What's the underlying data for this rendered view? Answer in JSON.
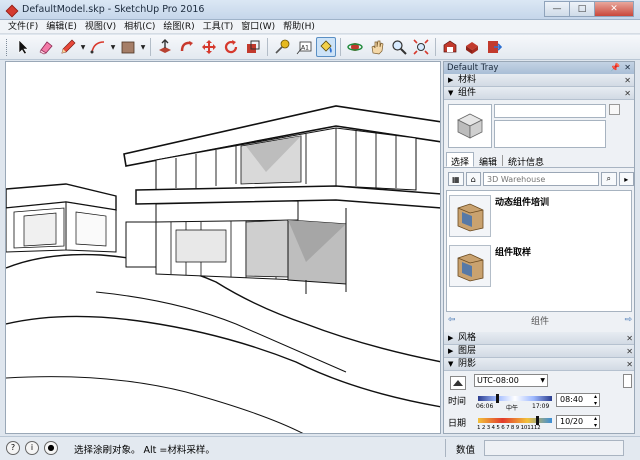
{
  "window": {
    "title": "DefaultModel.skp - SketchUp Pro 2016",
    "minimize": "—",
    "maximize": "□",
    "close": "✕"
  },
  "menu": [
    "文件(F)",
    "编辑(E)",
    "视图(V)",
    "相机(C)",
    "绘图(R)",
    "工具(T)",
    "窗口(W)",
    "帮助(H)"
  ],
  "toolbar": {
    "tools": [
      "select-tool",
      "eraser-tool",
      "pencil-tool",
      "arc-tool",
      "shape-tool",
      "push-pull-tool",
      "follow-me-tool",
      "move-tool",
      "rotate-tool",
      "scale-tool",
      "tape-measure-tool",
      "text-tool",
      "paint-bucket-tool",
      "orbit-tool",
      "pan-tool",
      "zoom-tool",
      "zoom-extents-tool",
      "warehouse-tool",
      "extension-tool",
      "share-tool"
    ],
    "text_tool_label": "A1",
    "active": "paint-bucket-tool"
  },
  "tray": {
    "title": "Default Tray",
    "pin": "📌",
    "close": "✕",
    "panels": {
      "materials": "材料",
      "components": "组件",
      "styles": "风格",
      "layers": "图层",
      "shadows": "阴影"
    },
    "tabs": [
      "选择",
      "编辑",
      "统计信息"
    ],
    "search_placeholder": "3D Warehouse",
    "component_items": [
      "动态组件培训",
      "组件取样"
    ],
    "list_label": "组件",
    "nav_back": "⇦",
    "nav_forward": "⇨"
  },
  "shadows": {
    "timezone": "UTC-08:00",
    "time_label": "时间",
    "date_label": "日期",
    "time_start": "06:06",
    "time_noon": "中午",
    "time_end": "17:09",
    "time_value": "08:40",
    "date_value": "10/20",
    "months": "1 2 3 4 5 6 7 8 9 101112",
    "time_fraction": 0.25,
    "date_fraction": 0.8
  },
  "status": {
    "message": "选择涂刷对象。 Alt =材料采样。",
    "measure_label": "数值",
    "icons": [
      "help-icon",
      "info-icon",
      "user-icon"
    ],
    "help_glyph": "?",
    "info_glyph": "i",
    "user_glyph": "●"
  },
  "colors": {
    "sky": "#ffffff",
    "tray_header": "#a9bed6",
    "accent": "#3b6fb0"
  }
}
